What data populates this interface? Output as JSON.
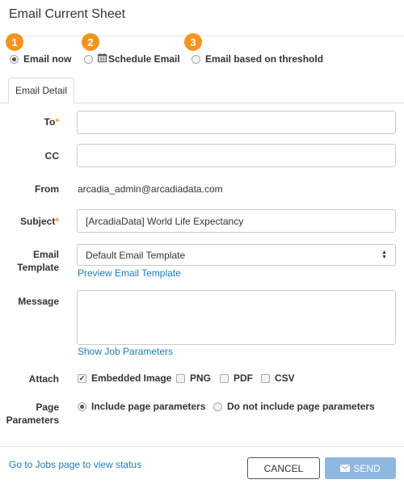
{
  "dialog": {
    "title": "Email Current Sheet"
  },
  "steps": [
    "1",
    "2",
    "3"
  ],
  "modes": {
    "email_now": "Email now",
    "schedule": "Schedule Email",
    "threshold": "Email based on threshold"
  },
  "tabs": {
    "email_detail": "Email Detail"
  },
  "form": {
    "to_label": "To",
    "cc_label": "CC",
    "from_label": "From",
    "from_value": "arcadia_admin@arcadiadata.com",
    "subject_label": "Subject",
    "subject_value": "[ArcadiaData] World Life Expectancy",
    "template_label_line1": "Email",
    "template_label_line2": "Template",
    "template_value": "Default Email Template",
    "preview_link": "Preview Email Template",
    "message_label": "Message",
    "job_params_link": "Show Job Parameters",
    "attach_label": "Attach",
    "attach_options": [
      "Embedded Image",
      "PNG",
      "PDF",
      "CSV"
    ],
    "page_params_label_line1": "Page",
    "page_params_label_line2": "Parameters",
    "page_params_options": [
      "Include page parameters",
      "Do not include page parameters"
    ],
    "required_mark": "*"
  },
  "footer": {
    "jobs_link": "Go to Jobs page to view status",
    "cancel": "CANCEL",
    "send": "SEND"
  },
  "colors": {
    "accent": "#f7941d",
    "link": "#1b7bbf",
    "send_button": "#8fb8e0"
  },
  "icons": {
    "schedule": "calendar-icon",
    "send": "envelope-icon"
  }
}
